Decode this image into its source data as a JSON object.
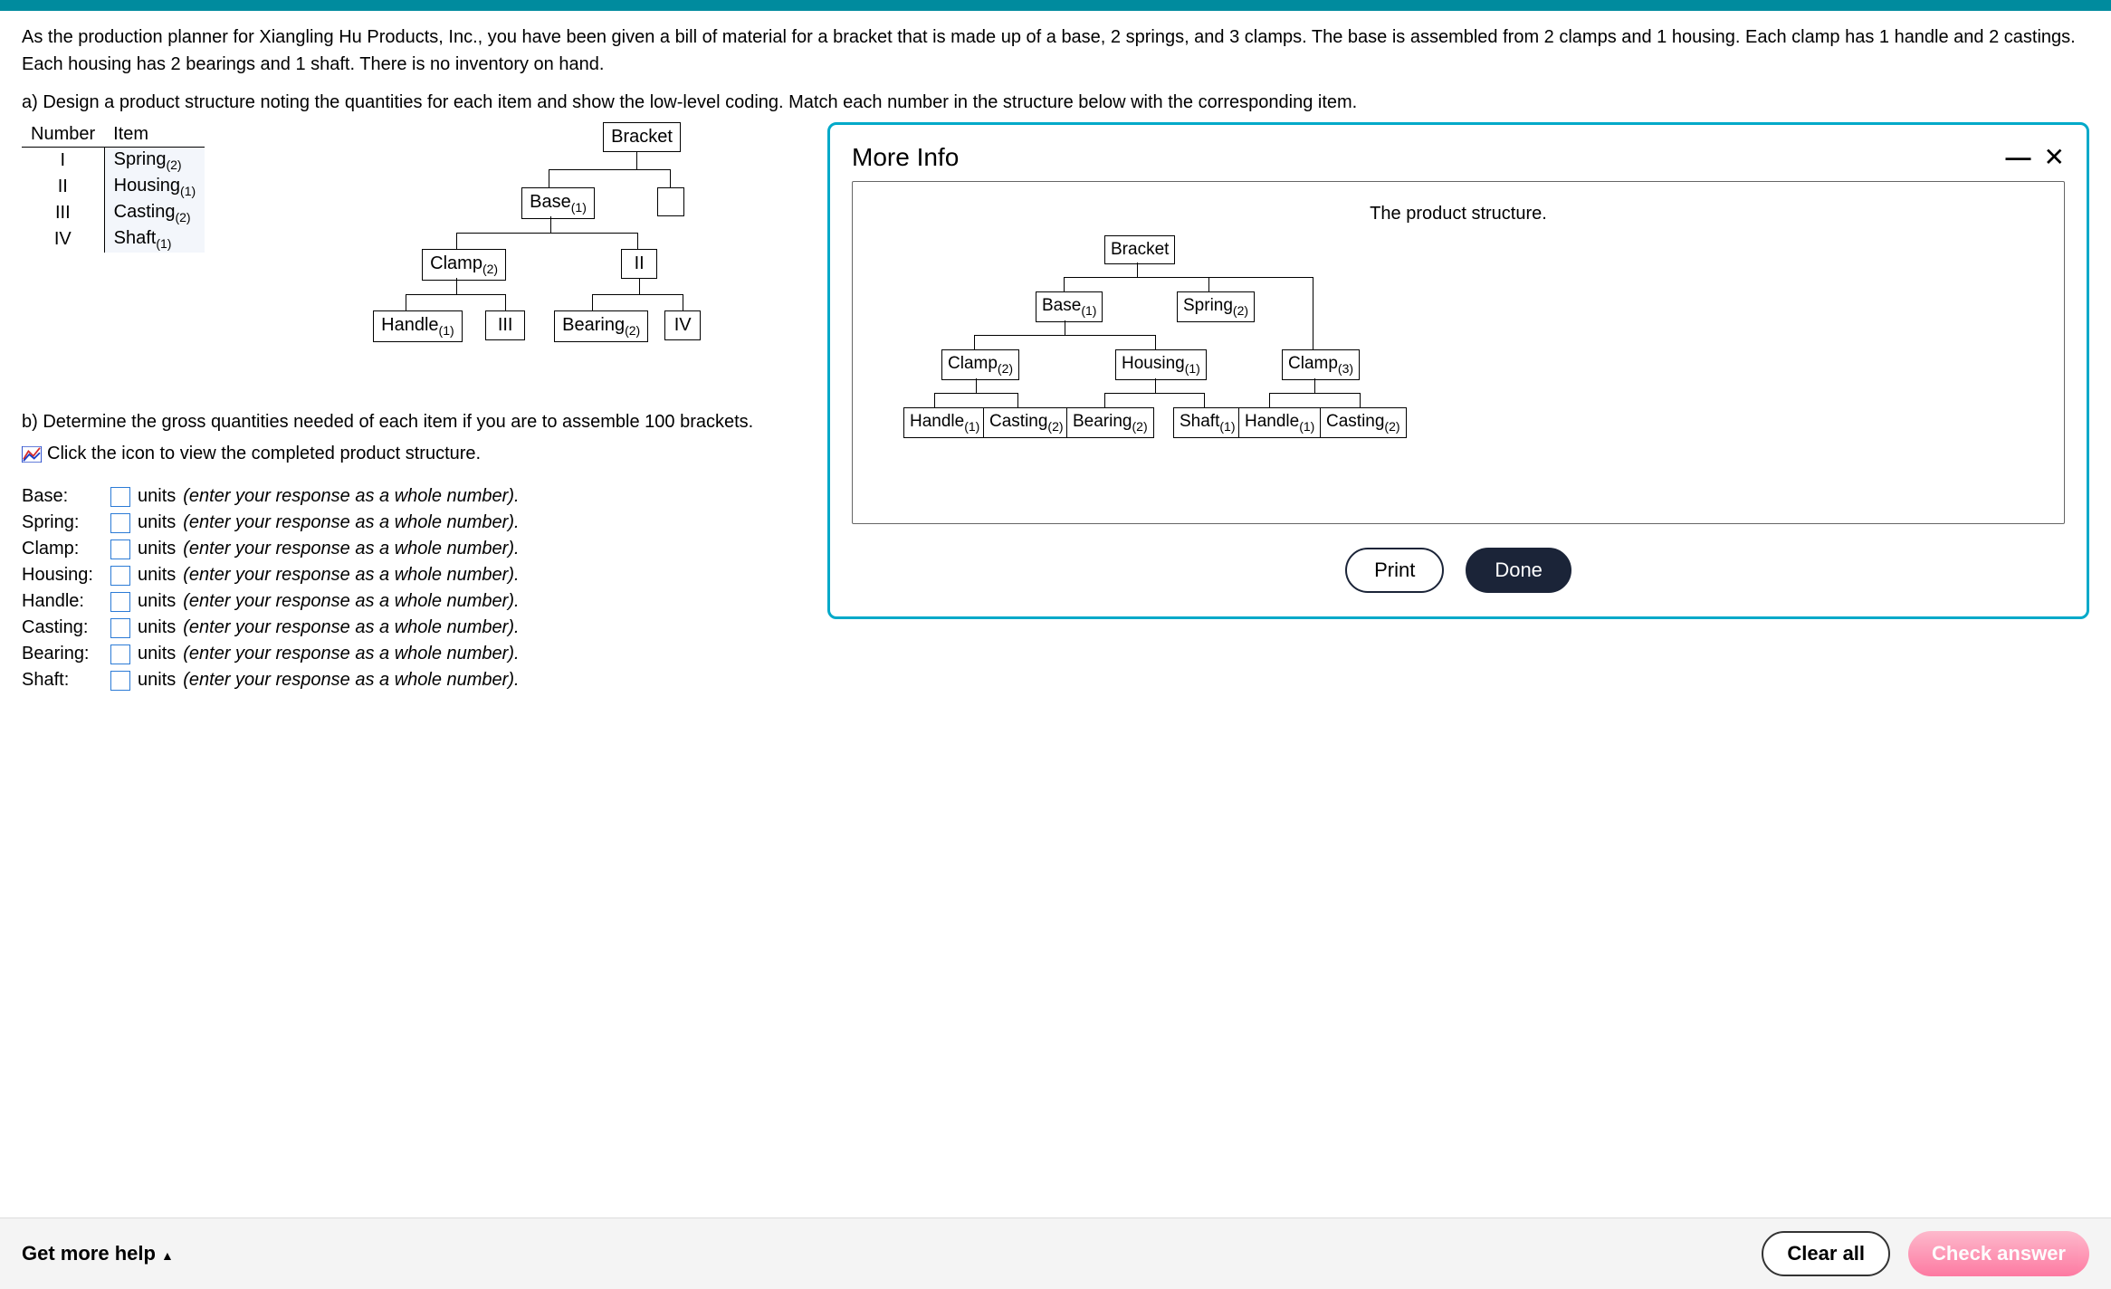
{
  "intro": "As the production planner for Xiangling Hu Products, Inc., you have been given a bill of material for a bracket that is made up of a base, 2 springs, and 3 clamps. The base is assembled from 2 clamps and 1 housing. Each clamp has 1 handle and 2 castings. Each housing has 2 bearings and 1 shaft. There is no inventory on hand.",
  "part_a": "a) Design a product structure noting the quantities for each item and show the low-level coding. Match each number in the structure below with the corresponding item.",
  "ni": {
    "head_number": "Number",
    "head_item": "Item",
    "rows": [
      {
        "n": "I",
        "item": "Spring",
        "sub": "(2)"
      },
      {
        "n": "II",
        "item": "Housing",
        "sub": "(1)"
      },
      {
        "n": "III",
        "item": "Casting",
        "sub": "(2)"
      },
      {
        "n": "IV",
        "item": "Shaft",
        "sub": "(1)"
      }
    ]
  },
  "tree_left": {
    "bracket": "Bracket",
    "base": "Base",
    "base_sub": "(1)",
    "clamp": "Clamp",
    "clamp_sub": "(2)",
    "II": "II",
    "handle": "Handle",
    "handle_sub": "(1)",
    "III": "III",
    "bearing": "Bearing",
    "bearing_sub": "(2)",
    "IV": "IV"
  },
  "part_b": "b) Determine the gross quantities needed of each item if you are to assemble 100 brackets.",
  "icon_link": "Click the icon to view the completed product structure.",
  "qty": {
    "items": [
      {
        "label": "Base:"
      },
      {
        "label": "Spring:"
      },
      {
        "label": "Clamp:"
      },
      {
        "label": "Housing:"
      },
      {
        "label": "Handle:"
      },
      {
        "label": "Casting:"
      },
      {
        "label": "Bearing:"
      },
      {
        "label": "Shaft:"
      }
    ],
    "units": "units",
    "hint": "(enter your response as a whole number)."
  },
  "modal": {
    "title": "More Info",
    "structure_title": "The product structure.",
    "bracket": "Bracket",
    "base": "Base",
    "base_sub": "(1)",
    "spring": "Spring",
    "spring_sub": "(2)",
    "clamp_l": "Clamp",
    "clamp_l_sub": "(2)",
    "housing": "Housing",
    "housing_sub": "(1)",
    "clamp_r": "Clamp",
    "clamp_r_sub": "(3)",
    "handle_l": "Handle",
    "handle_l_sub": "(1)",
    "casting_l": "Casting",
    "casting_l_sub": "(2)",
    "bearing": "Bearing",
    "bearing_sub": "(2)",
    "shaft": "Shaft",
    "shaft_sub": "(1)",
    "handle_r": "Handle",
    "handle_r_sub": "(1)",
    "casting_r": "Casting",
    "casting_r_sub": "(2)",
    "print": "Print",
    "done": "Done"
  },
  "footer": {
    "help": "Get more help",
    "clear": "Clear all",
    "check": "Check answer"
  }
}
